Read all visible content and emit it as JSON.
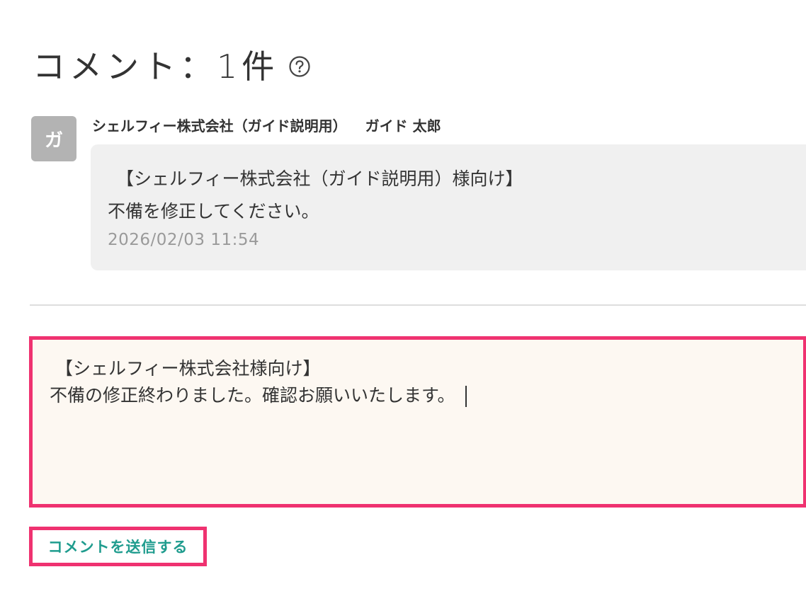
{
  "comments_section": {
    "heading": "コメント：1件",
    "help_icon": "help-circle-icon"
  },
  "comment": {
    "avatar_initial": "ガ",
    "author_company": "シェルフィー株式会社（ガイド説明用）",
    "author_name": "ガイド 太郎",
    "body_line1": "【シェルフィー株式会社（ガイド説明用）様向け】",
    "body_line2": "不備を修正してください。",
    "timestamp": "2026/02/03 11:54"
  },
  "reply_box": {
    "line1": "【シェルフィー株式会社様向け】",
    "line2": "不備の修正終わりました。確認お願いいたします。"
  },
  "actions": {
    "submit_label": "コメントを送信する"
  },
  "colors": {
    "highlight_border": "#ef3270",
    "link_teal": "#1f9c8e",
    "bubble_bg": "#f0f0f0",
    "textarea_bg": "#fdf8f2"
  }
}
